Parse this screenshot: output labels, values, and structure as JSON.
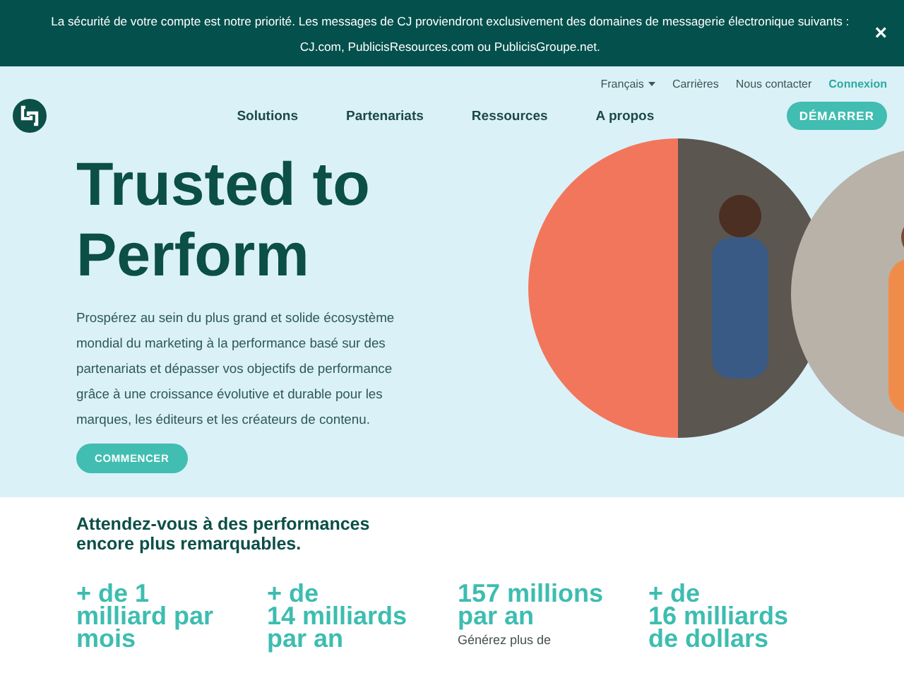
{
  "banner": {
    "message": "La sécurité de votre compte est notre priorité. Les messages de CJ proviendront exclusivement des domaines de messagerie électronique suivants : CJ.com, PublicisResources.com ou PublicisGroupe.net.",
    "close": "×"
  },
  "top_links": [
    {
      "label": "Français",
      "kind": "dropdown"
    },
    {
      "label": "Carrières",
      "kind": "link"
    },
    {
      "label": "Nous contacter",
      "kind": "link"
    },
    {
      "label": "Connexion",
      "kind": "accent"
    }
  ],
  "nav": {
    "items": [
      "Solutions",
      "Partenariats",
      "Ressources",
      "A propos"
    ],
    "cta": "DÉMARRER"
  },
  "hero": {
    "title": "Trusted to Perform",
    "body": "Prospérez au sein du plus grand et solide écosystème mondial du marketing à la performance basé sur des partenariats et dépasser vos objectifs de performance grâce à une croissance évolutive et durable pour les marques, les éditeurs et les créateurs de contenu.",
    "button": "COMMENCER"
  },
  "section": {
    "heading": "Attendez-vous à des performances encore plus remarquables."
  },
  "stats": [
    {
      "lines": [
        "+ de 1",
        "milliard par",
        "mois"
      ]
    },
    {
      "lines": [
        "+ de",
        "14 milliards",
        "par an"
      ]
    },
    {
      "lines": [
        "157 millions",
        "par an"
      ],
      "note": "Générez plus de"
    },
    {
      "lines": [
        "+ de",
        "16 milliards",
        "de dollars"
      ]
    }
  ]
}
